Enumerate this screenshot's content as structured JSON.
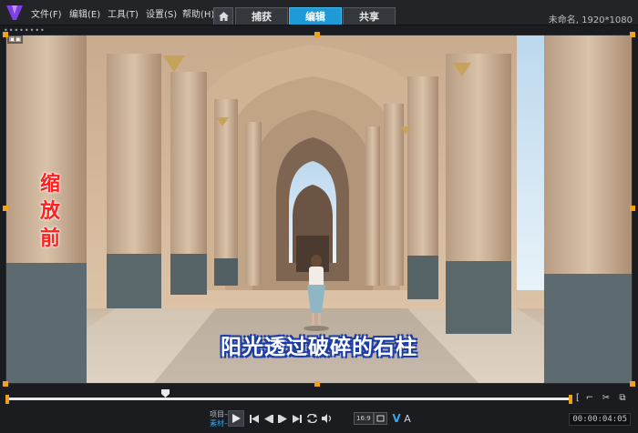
{
  "menu": {
    "file": "文件(F)",
    "edit": "编辑(E)",
    "tools": "工具(T)",
    "settings": "设置(S)",
    "help": "帮助(H)"
  },
  "workspace_tabs": {
    "capture": "捕获",
    "edit": "编辑",
    "share": "共享",
    "active": "编辑"
  },
  "project_info": "未命名, 1920*1080",
  "preview": {
    "overlay_label": "缩放前",
    "subtitle": "阳光透过破碎的石柱",
    "dots": "••••••••"
  },
  "scrubber": {
    "position_fraction": 0.28
  },
  "playback": {
    "mode_project": "项目–",
    "mode_clip": "素材–",
    "size_select": "16:9",
    "text_tool": "A",
    "timecode": "00:00:04:05"
  },
  "colors": {
    "accent": "#1e9ad6",
    "handle": "#f0a21a",
    "label_red": "#ff2020",
    "subtitle_outline": "#1b3ea8"
  }
}
